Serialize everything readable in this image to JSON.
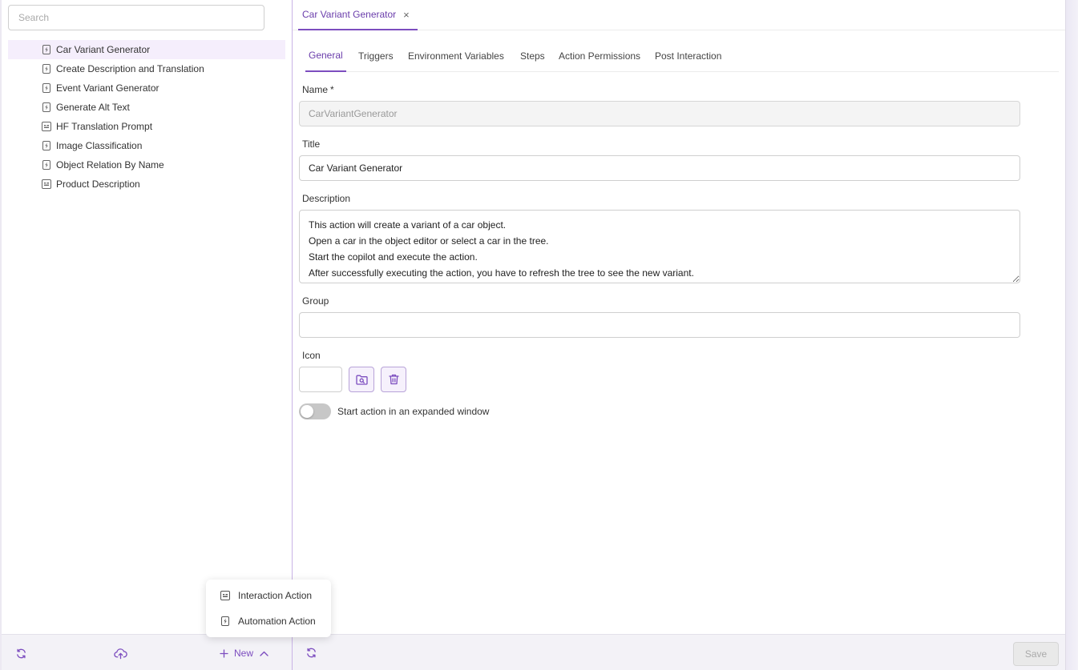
{
  "sidebar": {
    "search_placeholder": "Search",
    "items": [
      {
        "label": "Car Variant Generator",
        "icon": "automation-action-icon",
        "selected": true
      },
      {
        "label": "Create Description and Translation",
        "icon": "automation-action-icon"
      },
      {
        "label": "Event Variant Generator",
        "icon": "automation-action-icon"
      },
      {
        "label": "Generate Alt Text",
        "icon": "automation-action-icon"
      },
      {
        "label": "HF Translation Prompt",
        "icon": "interaction-action-icon"
      },
      {
        "label": "Image Classification",
        "icon": "automation-action-icon"
      },
      {
        "label": "Object Relation By Name",
        "icon": "automation-action-icon"
      },
      {
        "label": "Product Description",
        "icon": "interaction-action-icon"
      }
    ],
    "footer": {
      "new_label": "New"
    }
  },
  "new_menu": {
    "items": [
      {
        "label": "Interaction Action",
        "icon": "interaction-action-icon"
      },
      {
        "label": "Automation Action",
        "icon": "automation-action-icon"
      }
    ]
  },
  "main": {
    "doc_tab": {
      "label": "Car Variant Generator",
      "close": "×"
    },
    "tabs": [
      {
        "label": "General",
        "active": true
      },
      {
        "label": "Triggers"
      },
      {
        "label": "Environment Variables"
      },
      {
        "label": "Steps"
      },
      {
        "label": "Action Permissions"
      },
      {
        "label": "Post Interaction"
      }
    ],
    "form": {
      "name_label": "Name",
      "name_required": "*",
      "name_value": "CarVariantGenerator",
      "title_label": "Title",
      "title_value": "Car Variant Generator",
      "description_label": "Description",
      "description_lines": [
        "This action will create a variant of a car object.",
        "Open a car in the object editor or select a car in the tree.",
        "Start the copilot and execute the action.",
        "After successfully executing the action, you have to refresh the tree to see the new variant."
      ],
      "group_label": "Group",
      "group_value": "",
      "icon_label": "Icon",
      "toggle_label": "Start action in an expanded window",
      "toggle_on": false
    },
    "footer": {
      "save_label": "Save"
    }
  },
  "colors": {
    "accent": "#7c4dbf",
    "selected_bg": "#f5eefc",
    "footer_bg": "#f3f2f7"
  }
}
